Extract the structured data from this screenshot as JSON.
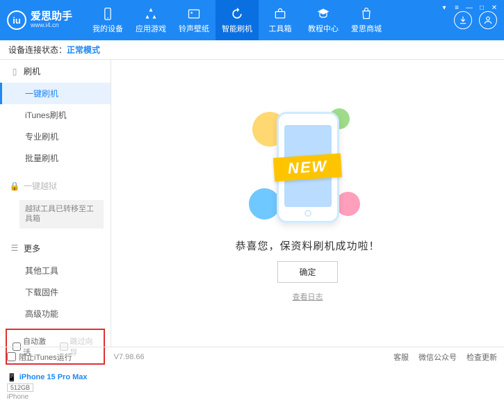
{
  "app": {
    "title": "爱思助手",
    "url": "www.i4.cn",
    "logo_char": "iu"
  },
  "nav": [
    {
      "label": "我的设备"
    },
    {
      "label": "应用游戏"
    },
    {
      "label": "铃声壁纸"
    },
    {
      "label": "智能刷机"
    },
    {
      "label": "工具箱"
    },
    {
      "label": "教程中心"
    },
    {
      "label": "爱思商城"
    }
  ],
  "status": {
    "label": "设备连接状态：",
    "mode": "正常模式"
  },
  "sidebar": {
    "sec1": {
      "title": "刷机"
    },
    "items1": [
      {
        "label": "一键刷机"
      },
      {
        "label": "iTunes刷机"
      },
      {
        "label": "专业刷机"
      },
      {
        "label": "批量刷机"
      }
    ],
    "sec2": {
      "title": "一键越狱"
    },
    "note": "越狱工具已转移至工具箱",
    "sec3": {
      "title": "更多"
    },
    "items3": [
      {
        "label": "其他工具"
      },
      {
        "label": "下载固件"
      },
      {
        "label": "高级功能"
      }
    ],
    "checkboxes": {
      "auto_activate": "自动激活",
      "skip_guide": "跳过向导"
    },
    "device": {
      "name": "iPhone 15 Pro Max",
      "storage": "512GB",
      "type": "iPhone"
    }
  },
  "main": {
    "banner": "NEW",
    "message": "恭喜您，保资料刷机成功啦！",
    "ok": "确定",
    "log": "查看日志"
  },
  "footer": {
    "block_itunes": "阻止iTunes运行",
    "version": "V7.98.66",
    "links": {
      "service": "客服",
      "wechat": "微信公众号",
      "update": "检查更新"
    }
  }
}
